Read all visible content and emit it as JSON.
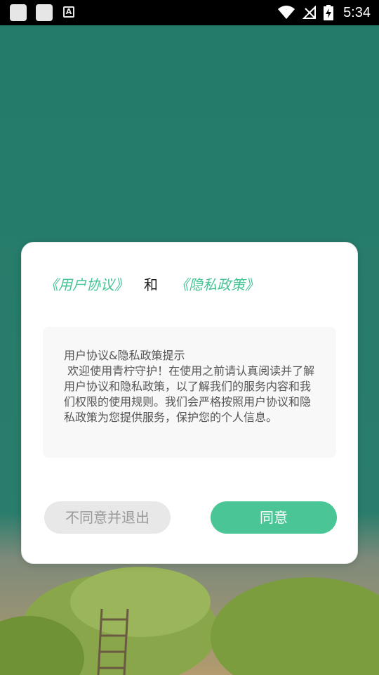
{
  "status_bar": {
    "time": "5:34",
    "icons": [
      "notification-square-icon",
      "notification-square-icon",
      "text-a-icon",
      "wifi-icon",
      "no-signal-icon",
      "battery-charging-icon"
    ],
    "a_icon_glyph": "A"
  },
  "dialog": {
    "user_agreement_link": "《用户协议》",
    "conjunction": "和",
    "privacy_policy_link": "《隐私政策》",
    "body_text": "用户协议&隐私政策提示\n 欢迎使用青柠守护！在使用之前请认真阅读并了解用户协议和隐私政策，以了解我们的服务内容和我们权限的使用规则。我们会严格按照用户协议和隐私政策为您提供服务，保护您的个人信息。",
    "decline_label": "不同意并退出",
    "agree_label": "同意"
  },
  "colors": {
    "accent": "#4ac696",
    "link": "#45c494",
    "background": "#247b69",
    "decline_bg": "#e8e8e8"
  }
}
